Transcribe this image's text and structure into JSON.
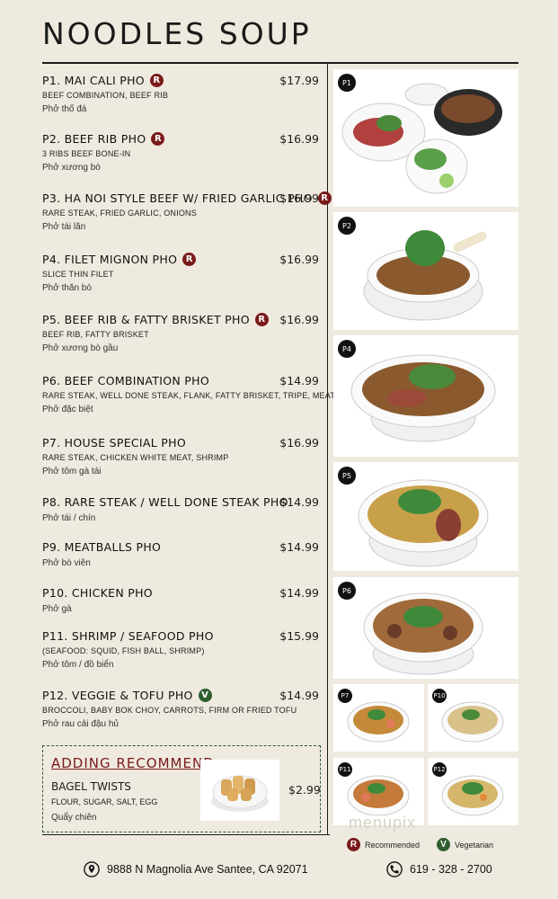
{
  "title": "NOODLES SOUP",
  "items": [
    {
      "name": "P1. MAI CALI PHO",
      "badge": "R",
      "price": "$17.99",
      "desc": "BEEF COMBINATION, BEEF RIB",
      "viet": "Phở thố đá"
    },
    {
      "name": "P2. BEEF RIB PHO",
      "badge": "R",
      "price": "$16.99",
      "desc": "3 RIBS BEEF BONE-IN",
      "viet": "Phở xương bò"
    },
    {
      "name": "P3. HA NOI STYLE BEEF W/ FRIED GARLIC PHO",
      "badge": "R",
      "price": "$16.99",
      "desc": "RARE STEAK, FRIED GARLIC, ONIONS",
      "viet": "Phở tái lăn"
    },
    {
      "name": "P4. FILET MIGNON PHO",
      "badge": "R",
      "price": "$16.99",
      "desc": "SLICE THIN FILET",
      "viet": "Phở thăn bò"
    },
    {
      "name": "P5. BEEF RIB & FATTY BRISKET PHO",
      "badge": "R",
      "price": "$16.99",
      "desc": "BEEF RIB, FATTY BRISKET",
      "viet": "Phở xương bò gầu"
    },
    {
      "name": "P6. BEEF COMBINATION PHO",
      "badge": "",
      "price": "$14.99",
      "desc": "RARE STEAK, WELL DONE STEAK, FLANK, FATTY BRISKET, TRIPE, MEATBALLS",
      "viet": "Phở đặc biệt"
    },
    {
      "name": "P7. HOUSE SPECIAL PHO",
      "badge": "",
      "price": "$16.99",
      "desc": "RARE STEAK, CHICKEN WHITE MEAT, SHRIMP",
      "viet": "Phở tôm gà tái"
    },
    {
      "name": "P8. RARE STEAK / WELL DONE STEAK PHO",
      "badge": "",
      "price": "$14.99",
      "desc": "",
      "viet": "Phở tái / chín"
    },
    {
      "name": "P9. MEATBALLS PHO",
      "badge": "",
      "price": "$14.99",
      "desc": "",
      "viet": "Phở bò viên"
    },
    {
      "name": "P10. CHICKEN PHO",
      "badge": "",
      "price": "$14.99",
      "desc": "",
      "viet": "Phở gà"
    },
    {
      "name": "P11. SHRIMP / SEAFOOD PHO",
      "badge": "",
      "price": "$15.99",
      "desc": "(SEAFOOD: SQUID, FISH BALL, SHRIMP)",
      "viet": "Phở tôm / đồ biển"
    },
    {
      "name": "P12. VEGGIE & TOFU PHO",
      "badge": "V",
      "price": "$14.99",
      "desc": "BROCCOLI, BABY BOK CHOY, CARROTS, FIRM OR FRIED TOFU",
      "viet": "Phở rau cải đậu hủ"
    }
  ],
  "adding": {
    "heading": "ADDING RECOMMEND",
    "name": "BAGEL TWISTS",
    "desc": "FLOUR, SUGAR, SALT, EGG",
    "viet": "Quẩy chiên",
    "price": "$2.99"
  },
  "photos": {
    "p1": "P1",
    "p2": "P2",
    "p4": "P4",
    "p5": "P5",
    "p6": "P6",
    "p7": "P7",
    "p10": "P10",
    "p11": "P11",
    "p12": "P12"
  },
  "legend": {
    "r_symbol": "R",
    "r_label": "Recommended",
    "v_symbol": "V",
    "v_label": "Vegetarian"
  },
  "footer": {
    "address": "9888 N Magnolia Ave Santee, CA 92071",
    "phone": "619 - 328 - 2700"
  },
  "watermark": "menupix",
  "colors": {
    "background": "#efeadf",
    "recommended": "#7a1a1a",
    "vegetarian": "#2e5d2e",
    "border": "#2c5a3a"
  }
}
